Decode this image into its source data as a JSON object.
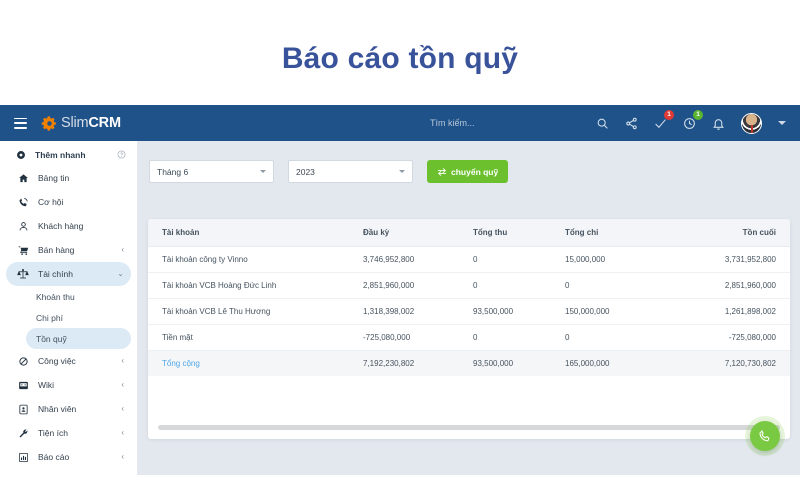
{
  "page": {
    "title": "Báo cáo tồn quỹ"
  },
  "colors": {
    "navbar_blue": "#1f5289",
    "title_blue": "#39539b",
    "accent_green": "#6cc02e",
    "fab_green": "#7ac943",
    "total_link_blue": "#4ea6e8",
    "content_bg": "#e3e8ee",
    "badge_red": "#e13b36",
    "badge_green": "#5cb531",
    "brand_orange": "#f08000"
  },
  "navbar": {
    "menu_icon": "hamburger-icon",
    "brand_light": "Slim",
    "brand_bold": "CRM",
    "brand_icon": "gear-icon",
    "search_placeholder": "Tìm kiếm...",
    "icons": [
      {
        "name": "search-icon",
        "badge": ""
      },
      {
        "name": "share-icon",
        "badge": ""
      },
      {
        "name": "check-icon",
        "badge": "1",
        "badge_color": "red"
      },
      {
        "name": "clock-icon",
        "badge": "1",
        "badge_color": "green"
      },
      {
        "name": "bell-icon",
        "badge": ""
      }
    ],
    "avatar": "user-avatar",
    "caret": "chevron-down-icon"
  },
  "sidebar": {
    "quick_add": {
      "label": "Thêm nhanh",
      "icon": "plus-circle-icon",
      "help_icon": "help-circle-icon"
    },
    "items": [
      {
        "label": "Bảng tin",
        "icon": "home-icon",
        "chevron": "",
        "active": false
      },
      {
        "label": "Cơ hội",
        "icon": "phone-icon",
        "chevron": "",
        "active": false
      },
      {
        "label": "Khách hàng",
        "icon": "user-icon",
        "chevron": "",
        "active": false
      },
      {
        "label": "Bán hàng",
        "icon": "cart-icon",
        "chevron": "‹",
        "active": false
      },
      {
        "label": "Tài chính",
        "icon": "scales-icon",
        "chevron": "⌄",
        "active": true
      }
    ],
    "sub_items": [
      {
        "label": "Khoản thu",
        "active": false
      },
      {
        "label": "Chi phí",
        "active": false
      },
      {
        "label": "Tồn quỹ",
        "active": true
      }
    ],
    "items_bottom": [
      {
        "label": "Công việc",
        "icon": "briefcase-icon",
        "chevron": "‹"
      },
      {
        "label": "Wiki",
        "icon": "book-icon",
        "chevron": "‹"
      },
      {
        "label": "Nhân viên",
        "icon": "id-card-icon",
        "chevron": "‹"
      },
      {
        "label": "Tiện ích",
        "icon": "wrench-icon",
        "chevron": "‹"
      },
      {
        "label": "Báo cáo",
        "icon": "chart-bar-icon",
        "chevron": "‹"
      }
    ]
  },
  "filters": {
    "month": {
      "value": "Tháng 6",
      "caret": "chevron-down-icon"
    },
    "year": {
      "value": "2023",
      "caret": "chevron-down-icon"
    },
    "transfer_button": {
      "label": "chuyển quỹ",
      "icon": "exchange-arrows-icon"
    }
  },
  "table": {
    "columns": [
      "Tài khoản",
      "Đầu kỳ",
      "Tổng thu",
      "Tổng chi",
      "Tồn cuối"
    ],
    "rows": [
      {
        "account": "Tài khoản công ty Vinno",
        "opening": "3,746,952,800",
        "income": "0",
        "expense": "15,000,000",
        "closing": "3,731,952,800"
      },
      {
        "account": "Tài khoản VCB Hoàng Đức Linh",
        "opening": "2,851,960,000",
        "income": "0",
        "expense": "0",
        "closing": "2,851,960,000"
      },
      {
        "account": "Tài khoản VCB Lê Thu Hương",
        "opening": "1,318,398,002",
        "income": "93,500,000",
        "expense": "150,000,000",
        "closing": "1,261,898,002"
      },
      {
        "account": "Tiền mặt",
        "opening": "-725,080,000",
        "income": "0",
        "expense": "0",
        "closing": "-725,080,000"
      }
    ],
    "total_row": {
      "account": "Tổng cộng",
      "opening": "7,192,230,802",
      "income": "93,500,000",
      "expense": "165,000,000",
      "closing": "7,120,730,802"
    }
  },
  "fab": {
    "icon": "phone-icon"
  }
}
